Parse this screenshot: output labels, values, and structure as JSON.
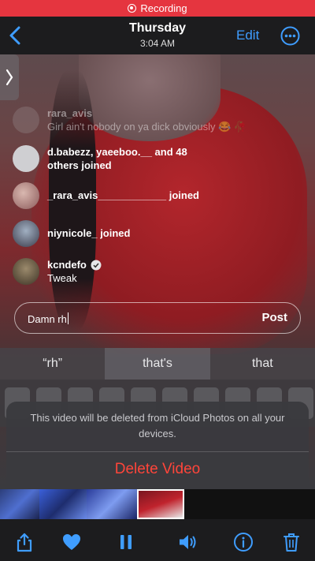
{
  "recording": {
    "label": "Recording",
    "color": "#e5353f"
  },
  "nav": {
    "day": "Thursday",
    "time": "3:04 AM",
    "edit_label": "Edit",
    "accent": "#3f9dff"
  },
  "comments": [
    {
      "user": "rara_avis",
      "text": "Girl ain't nobody on ya dick obviously 😂 🥀",
      "faded": true
    },
    {
      "user": "d.babezz, yaeeboo.__ and 48 others joined",
      "text": ""
    },
    {
      "user": "_rara_avis____________ joined",
      "text": ""
    },
    {
      "user": "niynicole_ joined",
      "text": ""
    },
    {
      "user": "kcndefo",
      "text": "Tweak",
      "verified": true
    }
  ],
  "input": {
    "value": "Damn rh",
    "post_label": "Post"
  },
  "suggestions": [
    "“rh”",
    "that's",
    "that"
  ],
  "alert": {
    "message": "This video will be deleted from iCloud Photos on all your devices.",
    "delete_label": "Delete Video",
    "delete_color": "#ff453a"
  },
  "toolbar": {
    "icons": [
      "share-icon",
      "heart-icon",
      "pause-icon",
      "volume-icon",
      "info-icon",
      "trash-icon"
    ]
  }
}
